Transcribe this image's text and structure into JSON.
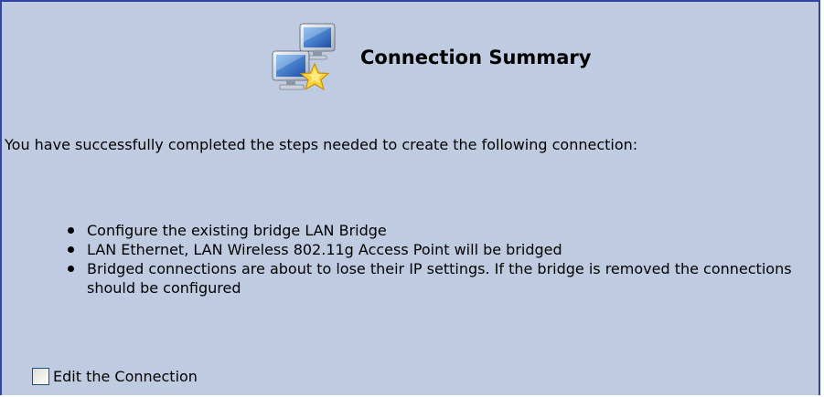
{
  "header": {
    "icon": "network-connection-wizard-icon",
    "title": "Connection Summary"
  },
  "intro": {
    "text": "You have successfully completed the steps needed to create the following connection:"
  },
  "summary_items": [
    {
      "text": "Configure the existing bridge LAN Bridge"
    },
    {
      "text": "LAN Ethernet, LAN Wireless 802.11g Access Point will be bridged"
    },
    {
      "text": "Bridged connections are about to lose their IP settings. If the bridge is removed the connections should be configured"
    }
  ],
  "edit_option": {
    "label": "Edit the Connection",
    "checked": false
  },
  "colors": {
    "panel_background": "#bfcbe0",
    "panel_border": "#3344a8"
  }
}
